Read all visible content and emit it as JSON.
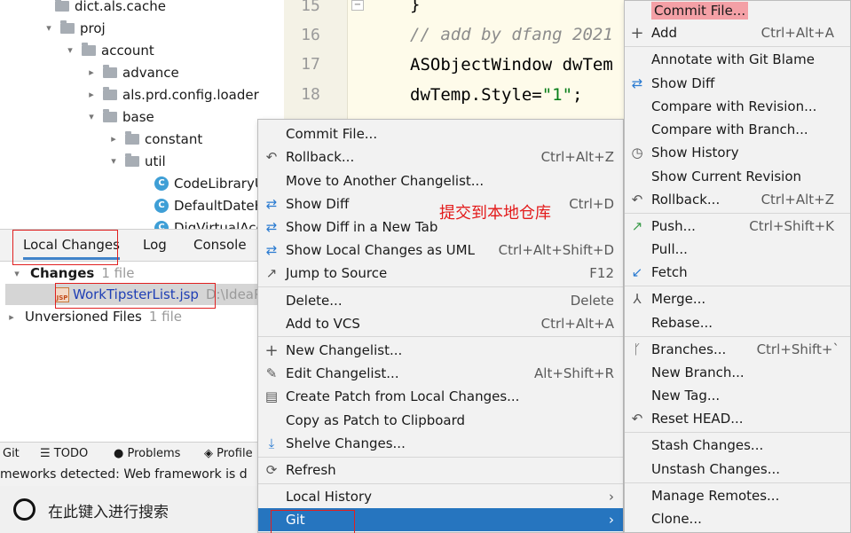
{
  "project_tree": {
    "items": [
      {
        "label": "dict.als.cache",
        "kind": "folder",
        "arrow": "▸",
        "depth": 3
      },
      {
        "label": "proj",
        "kind": "folder",
        "arrow": "▾",
        "depth": 2
      },
      {
        "label": "account",
        "kind": "folder",
        "arrow": "▾",
        "depth": 3
      },
      {
        "label": "advance",
        "kind": "folder",
        "arrow": "▸",
        "depth": 4
      },
      {
        "label": "als.prd.config.loader",
        "kind": "folder",
        "arrow": "▸",
        "depth": 4
      },
      {
        "label": "base",
        "kind": "folder",
        "arrow": "▾",
        "depth": 4
      },
      {
        "label": "constant",
        "kind": "folder",
        "arrow": "▸",
        "depth": 5
      },
      {
        "label": "util",
        "kind": "folder",
        "arrow": "▾",
        "depth": 5
      },
      {
        "label": "CodeLibraryU",
        "kind": "class",
        "arrow": "",
        "depth": 6
      },
      {
        "label": "DefaultDateH",
        "kind": "class",
        "arrow": "",
        "depth": 6
      },
      {
        "label": "DigVirtualAcc",
        "kind": "class",
        "arrow": "",
        "depth": 6
      }
    ]
  },
  "editor": {
    "lines": [
      {
        "no": "15",
        "text": "}"
      },
      {
        "no": "16",
        "comment": "// add by dfang 2021"
      },
      {
        "no": "17",
        "text": "ASObjectWindow dwTem"
      },
      {
        "no": "18",
        "text_before": "dwTemp.Style=",
        "string": "\"1\"",
        "text_after": ";"
      }
    ]
  },
  "changes_panel": {
    "tabs": [
      "Local Changes",
      "Log",
      "Console"
    ],
    "changes_label": "Changes",
    "changes_count": "1 file",
    "file_name": "WorkTipsterList.jsp",
    "file_path": "D:\\IdeaP",
    "unversioned_label": "Unversioned Files",
    "unversioned_count": "1 file"
  },
  "bottom_bar": {
    "items": [
      "Git",
      "TODO",
      "Problems",
      "Profile"
    ]
  },
  "status_text": "meworks detected: Web framework is d",
  "taskbar": {
    "search_placeholder": "在此键入进行搜索"
  },
  "annotation": "提交到本地仓库",
  "context_menu": {
    "items": [
      {
        "label": "Commit File...",
        "icon": "",
        "shortcut": ""
      },
      {
        "label": "Rollback...",
        "icon": "rollback-icon",
        "shortcut": "Ctrl+Alt+Z"
      },
      {
        "label": "Move to Another Changelist...",
        "icon": "",
        "shortcut": ""
      },
      {
        "label": "Show Diff",
        "icon": "diff-icon",
        "shortcut": "Ctrl+D"
      },
      {
        "label": "Show Diff in a New Tab",
        "icon": "diff-icon",
        "shortcut": ""
      },
      {
        "label": "Show Local Changes as UML",
        "icon": "uml-icon",
        "shortcut": "Ctrl+Alt+Shift+D"
      },
      {
        "label": "Jump to Source",
        "icon": "jump-icon",
        "shortcut": "F12"
      },
      {
        "label": "Delete...",
        "icon": "",
        "shortcut": "Delete"
      },
      {
        "label": "Add to VCS",
        "icon": "",
        "shortcut": "Ctrl+Alt+A"
      },
      {
        "label": "New Changelist...",
        "icon": "plus-icon",
        "shortcut": ""
      },
      {
        "label": "Edit Changelist...",
        "icon": "pencil-icon",
        "shortcut": "Alt+Shift+R"
      },
      {
        "label": "Create Patch from Local Changes...",
        "icon": "patch-icon",
        "shortcut": ""
      },
      {
        "label": "Copy as Patch to Clipboard",
        "icon": "",
        "shortcut": ""
      },
      {
        "label": "Shelve Changes...",
        "icon": "shelve-icon",
        "shortcut": ""
      },
      {
        "label": "Refresh",
        "icon": "refresh-icon",
        "shortcut": ""
      },
      {
        "label": "Local History",
        "icon": "",
        "shortcut": "",
        "submenu": "›"
      },
      {
        "label": "Git",
        "icon": "",
        "shortcut": "",
        "submenu": "›"
      }
    ]
  },
  "git_submenu": {
    "items": [
      {
        "label": "Commit File...",
        "icon": "",
        "shortcut": ""
      },
      {
        "label": "Add",
        "icon": "plus-icon",
        "shortcut": "Ctrl+Alt+A"
      },
      {
        "label": "Annotate with Git Blame",
        "icon": "",
        "shortcut": ""
      },
      {
        "label": "Show Diff",
        "icon": "diff-icon",
        "shortcut": ""
      },
      {
        "label": "Compare with Revision...",
        "icon": "",
        "shortcut": ""
      },
      {
        "label": "Compare with Branch...",
        "icon": "",
        "shortcut": ""
      },
      {
        "label": "Show History",
        "icon": "clock-icon",
        "shortcut": ""
      },
      {
        "label": "Show Current Revision",
        "icon": "",
        "shortcut": ""
      },
      {
        "label": "Rollback...",
        "icon": "rollback-icon",
        "shortcut": "Ctrl+Alt+Z"
      },
      {
        "label": "Push...",
        "icon": "push-icon",
        "shortcut": "Ctrl+Shift+K"
      },
      {
        "label": "Pull...",
        "icon": "",
        "shortcut": ""
      },
      {
        "label": "Fetch",
        "icon": "fetch-icon",
        "shortcut": ""
      },
      {
        "label": "Merge...",
        "icon": "merge-icon",
        "shortcut": ""
      },
      {
        "label": "Rebase...",
        "icon": "",
        "shortcut": ""
      },
      {
        "label": "Branches...",
        "icon": "branch-icon",
        "shortcut": "Ctrl+Shift+`"
      },
      {
        "label": "New Branch...",
        "icon": "",
        "shortcut": ""
      },
      {
        "label": "New Tag...",
        "icon": "",
        "shortcut": ""
      },
      {
        "label": "Reset HEAD...",
        "icon": "rollback-icon",
        "shortcut": ""
      },
      {
        "label": "Stash Changes...",
        "icon": "",
        "shortcut": ""
      },
      {
        "label": "Unstash Changes...",
        "icon": "",
        "shortcut": ""
      },
      {
        "label": "Manage Remotes...",
        "icon": "",
        "shortcut": ""
      },
      {
        "label": "Clone...",
        "icon": "",
        "shortcut": ""
      }
    ]
  },
  "colors": {
    "selection": "#2675bf",
    "highlight_box": "#e02020",
    "commit_highlight": "#f4a0a6",
    "annotation_text": "#e31a1a"
  }
}
